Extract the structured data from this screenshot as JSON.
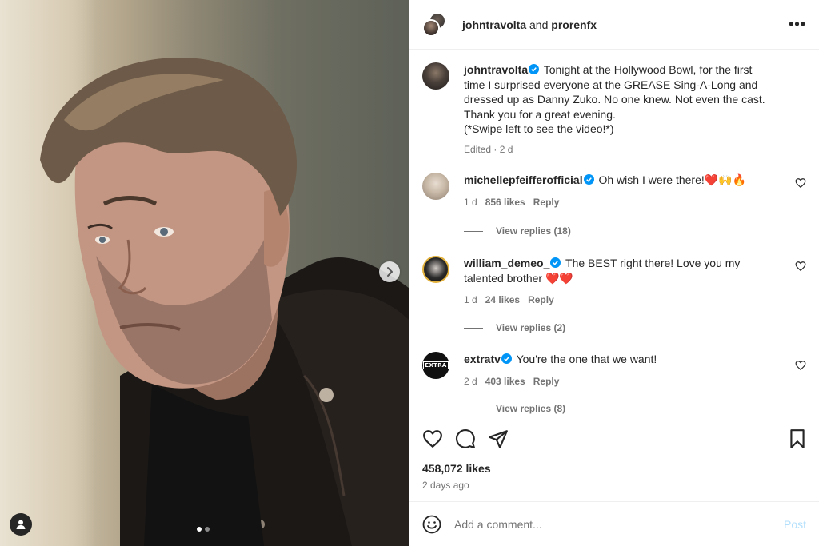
{
  "post": {
    "header": {
      "user1": "johntravolta",
      "and": "and",
      "user2": "prorenfx",
      "more": "•••"
    },
    "caption": {
      "username": "johntravolta",
      "text_line1": "Tonight at the Hollywood Bowl, for the first",
      "text_line2": "time I surprised everyone at the GREASE Sing-A-Long and",
      "text_line3": "dressed up as Danny Zuko. No one knew. Not even the cast.",
      "text_line4": "Thank you for a great evening.",
      "text_line5": "(*Swipe left to see the video!*)",
      "meta": "Edited · 2 d"
    },
    "comments": [
      {
        "username": "michellepfeifferofficial",
        "text": "Oh wish I were there!❤️🙌🔥",
        "age": "1 d",
        "likes": "856 likes",
        "reply": "Reply",
        "view_replies": "View replies (18)"
      },
      {
        "username": "william_demeo_",
        "text": "The BEST right there! Love you my",
        "text2": "talented brother ❤️❤️",
        "age": "1 d",
        "likes": "24 likes",
        "reply": "Reply",
        "view_replies": "View replies (2)"
      },
      {
        "username": "extratv",
        "text": "You're the one that we want!",
        "age": "2 d",
        "likes": "403 likes",
        "reply": "Reply",
        "view_replies": "View replies (8)",
        "avatar_text": "EXTRA"
      }
    ],
    "likes": "458,072 likes",
    "posted": "2 days ago",
    "add_comment": {
      "placeholder": "Add a comment...",
      "post_label": "Post"
    },
    "carousel": {
      "count": 2,
      "active": 1
    }
  },
  "colors": {
    "verified": "#0095f6",
    "muted": "#737373",
    "post_disabled": "#b2dffc",
    "text": "#262626"
  },
  "icons": [
    "more-icon",
    "verified-icon",
    "heart-icon",
    "comment-icon",
    "share-icon",
    "save-icon",
    "emoji-icon",
    "chevron-right-icon",
    "user-tag-icon"
  ]
}
